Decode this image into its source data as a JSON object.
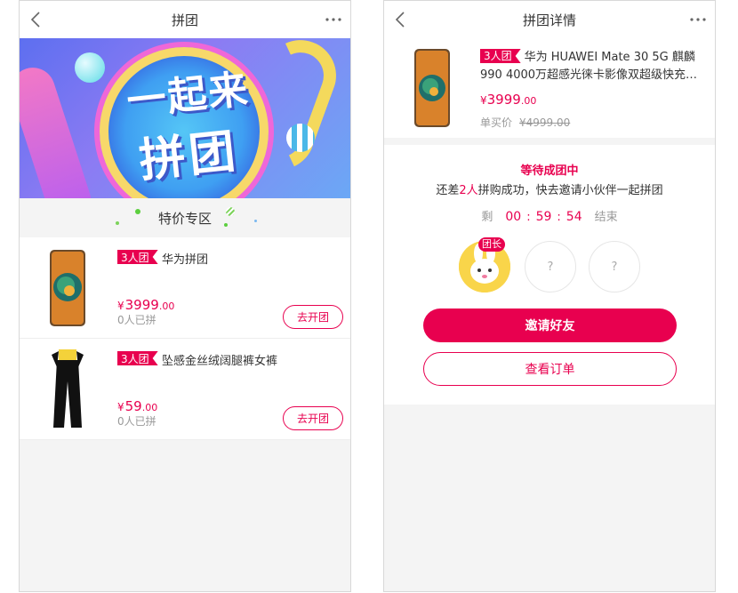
{
  "left": {
    "nav": {
      "title": "拼团"
    },
    "banner": {
      "line1": "一起来",
      "line2": "拼团"
    },
    "section": {
      "title": "特价专区"
    },
    "products": [
      {
        "tag": "3人团",
        "name": "华为拼团",
        "currency": "¥",
        "price_int": "3999",
        "price_dec": ".00",
        "sold": "0人已拼",
        "button": "去开团"
      },
      {
        "tag": "3人团",
        "name": "坠感金丝绒阔腿裤女裤",
        "currency": "¥",
        "price_int": "59",
        "price_dec": ".00",
        "sold": "0人已拼",
        "button": "去开团"
      }
    ]
  },
  "right": {
    "nav": {
      "title": "拼团详情"
    },
    "product": {
      "tag": "3人团",
      "title_line1": "华为 HUAWEI Mate 30 5G 麒麟",
      "title_line2": "990 4000万超感光徕卡影像双超级快充…",
      "currency": "¥",
      "price_int": "3999",
      "price_dec": ".00",
      "single_label": "单买价",
      "single_price": "¥4999.00"
    },
    "group": {
      "status": "等待成团中",
      "need_prefix": "还差",
      "need_count": "2人",
      "need_suffix": "拼购成功，快去邀请小伙伴一起拼团",
      "timer_prefix": "剩",
      "hours": "00",
      "minutes": "59",
      "seconds": "54",
      "timer_suffix": "结束",
      "leader_badge": "团长",
      "empty_slot": "?",
      "invite_button": "邀请好友",
      "order_button": "查看订单"
    }
  },
  "colors": {
    "accent": "#e8004f",
    "muted": "#999999",
    "bg": "#f4f4f4"
  }
}
